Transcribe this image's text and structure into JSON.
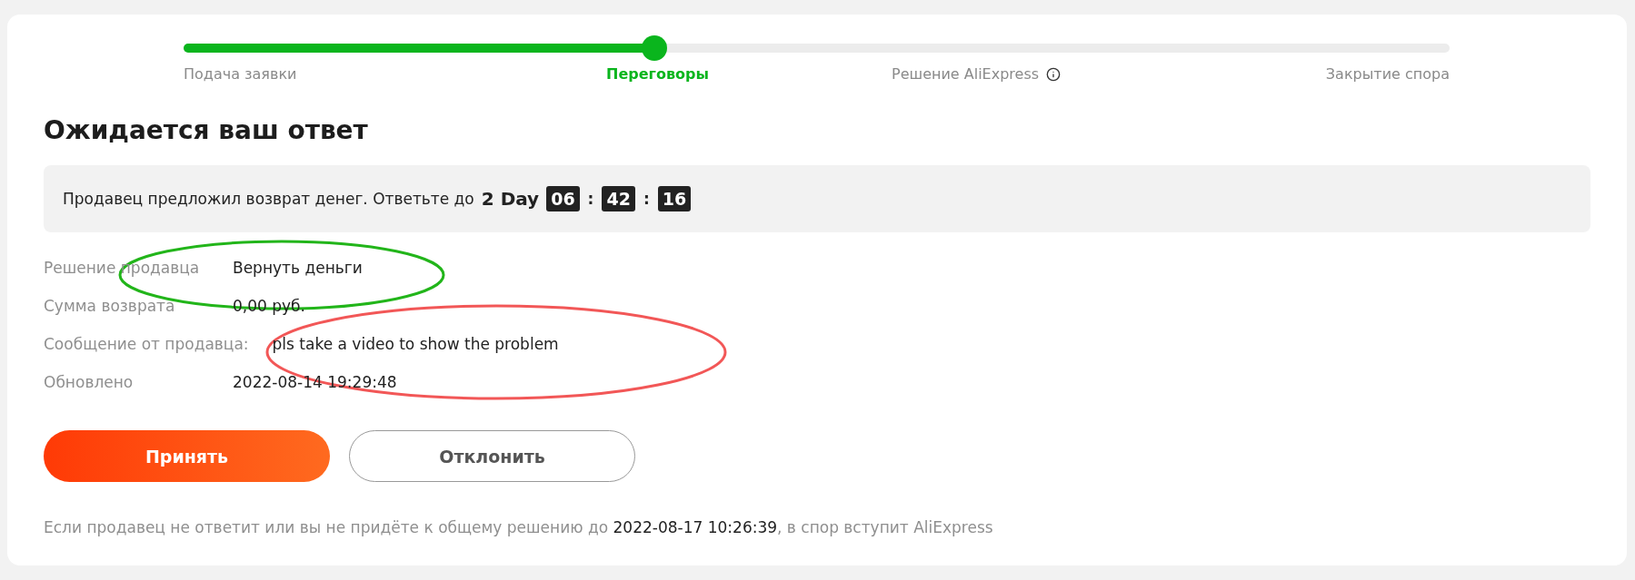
{
  "steps": [
    {
      "label": "Подача заявки",
      "selected": false,
      "info": false
    },
    {
      "label": "Переговоры",
      "selected": true,
      "info": false
    },
    {
      "label": "Решение AliExpress",
      "selected": false,
      "info": true
    },
    {
      "label": "Закрытие спора",
      "selected": false,
      "info": false
    }
  ],
  "progress": {
    "level": 0.372
  },
  "title": "Ожидается ваш ответ",
  "banner": {
    "text": "Продавец предложил возврат денег. Ответьте до",
    "days": "2 Day",
    "timer": [
      {
        "kind": "box",
        "text": "06"
      },
      {
        "kind": "sep",
        "text": ":"
      },
      {
        "kind": "box",
        "text": "42"
      },
      {
        "kind": "sep",
        "text": ":"
      },
      {
        "kind": "box",
        "text": "16"
      }
    ]
  },
  "details": [
    {
      "label": "Решение продавца",
      "value": "Вернуть деньги"
    },
    {
      "label": "Сумма возврата",
      "value": "0,00 руб."
    },
    {
      "label": "Сообщение от продавца:",
      "value": "pls take a video to show the problem"
    },
    {
      "label": "Обновлено",
      "value": "2022-08-14 19:29:48"
    }
  ],
  "buttons": [
    {
      "label": "Принять",
      "kind": "primary"
    },
    {
      "label": "Отклонить",
      "kind": "secondary"
    }
  ],
  "footer": {
    "before": "Если продавец не ответит или вы не придёте к общему решению до",
    "date": "2022-08-17 10:26:39",
    "after": ", в спор вступит AliExpress"
  },
  "annotations": [
    {
      "kind": "ellipse",
      "color": "#22b51a"
    },
    {
      "kind": "ellipse",
      "color": "#f25757"
    }
  ]
}
